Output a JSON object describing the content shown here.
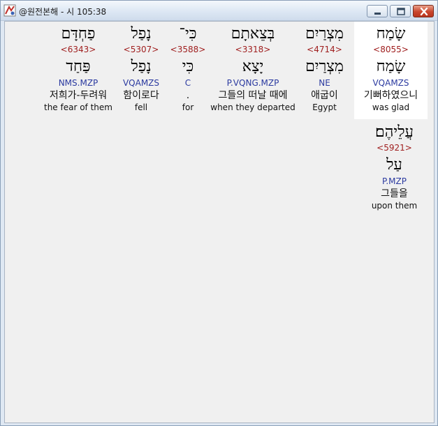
{
  "window": {
    "title": "@원전본해 - 시 105:38"
  },
  "icons": {
    "app": "app-icon",
    "minimize": "minimize-icon",
    "maximize": "maximize-icon",
    "close": "close-icon"
  },
  "colors": {
    "strong_number": "#a02020",
    "morphology": "#2b3aa0",
    "selected_background": "#ffffff"
  },
  "words": [
    {
      "hebrew": "שָׂמַח",
      "strong": "<8055>",
      "lemma": "שָׂמַח",
      "morph": "VQAMZS",
      "korean": "기뻐하였으니",
      "english": "was glad",
      "selected": true
    },
    {
      "hebrew": "מִצְרַיִם",
      "strong": "<4714>",
      "lemma": "מִצְרַיִם",
      "morph": "NE",
      "korean": "애굽이",
      "english": "Egypt"
    },
    {
      "hebrew": "בְּצֵאתָם",
      "strong": "<3318>",
      "lemma": "יָצָא",
      "morph": "P.VQNG.MZP",
      "korean": "그들의 떠날 때에",
      "english": "when they departed"
    },
    {
      "hebrew": "כִּי־",
      "strong": "<3588>",
      "lemma": "כִּי",
      "morph": "C",
      "korean": ".",
      "english": "for"
    },
    {
      "hebrew": "נָפַל",
      "strong": "<5307>",
      "lemma": "נָפַל",
      "morph": "VQAMZS",
      "korean": "함이로다",
      "english": "fell"
    },
    {
      "hebrew": "פַחְדָּם",
      "strong": "<6343>",
      "lemma": "פַּחַד",
      "morph": "NMS.MZP",
      "korean": "저희가-두려워",
      "english": "the fear of them"
    },
    {
      "hebrew": "עֲלֵיהֶם׃",
      "strong": "<5921>",
      "lemma": "עַל",
      "morph": "P.MZP",
      "korean": "그들을",
      "english": "upon them"
    }
  ]
}
